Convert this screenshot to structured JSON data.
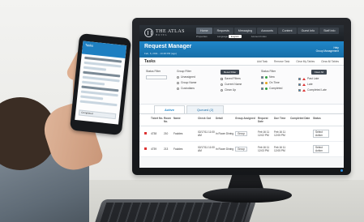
{
  "app": {
    "brand": "THE ATLAS",
    "brand_sub": "HOTEL",
    "nav": [
      "Home",
      "Requests",
      "Messaging",
      "Accounts",
      "Content",
      "Guest Info",
      "Staff Info"
    ],
    "sub_left": "Properties",
    "sub_mid": "Language",
    "language_value": "English",
    "sub_right": "Account Index"
  },
  "banner": {
    "title": "Request Manager",
    "date": "Feb, 6, 2011 - 10:48 PM (ago)",
    "right_line1": "Help",
    "right_line2": "Group Management"
  },
  "toolbar": {
    "title": "Tasks",
    "actions": [
      "Add Task",
      "Remove Task",
      "Clear My Tables",
      "Clear All Tables"
    ]
  },
  "filters": {
    "status_filter": "Status Filter",
    "group_filter": "Group Filter",
    "status_filter_2": "Status Filter",
    "reset_filter": "Reset Filter",
    "clear_all": "Clear All",
    "group_options": [
      "Unassigned",
      "Group Name",
      "Custodians"
    ],
    "assign_options": [
      "Saved Filters",
      "Current Name",
      "Clean Up"
    ],
    "status_options": [
      "New",
      "On Time",
      "Completed"
    ],
    "alert_options": [
      "Past Late",
      "Late",
      "Completed Late"
    ]
  },
  "tabs": [
    "Active",
    "Queued (2)"
  ],
  "table": {
    "headers": [
      "",
      "Ticket No.",
      "Room No.",
      "Name",
      "Check Out",
      "Detail",
      "Group Assigned",
      "Request Date",
      "Due Time",
      "Completed Date",
      "Status"
    ],
    "rows": [
      [
        "",
        "4738",
        "210",
        "Fauldes",
        "02/17/11 11:00 AM",
        "In Room Dining",
        "Group",
        "Feb 16 11 12:02 PM",
        "Feb 16 11 12:05 PM",
        "",
        "Select Action"
      ],
      [
        "",
        "4739",
        "213",
        "Fauldes",
        "02/17/11 11:00 AM",
        "In Room Dining",
        "Group",
        "Feb 16 11 12:03 PM",
        "Feb 16 11 12:05 PM",
        "",
        "Select Action"
      ]
    ]
  },
  "phone": {
    "title": "Tasks",
    "tab": "Completed"
  },
  "colors": {
    "accent": "#1f86c9",
    "header_dark": "#1b1f24",
    "alert": "#d33333",
    "ok": "#2e9e3f"
  }
}
